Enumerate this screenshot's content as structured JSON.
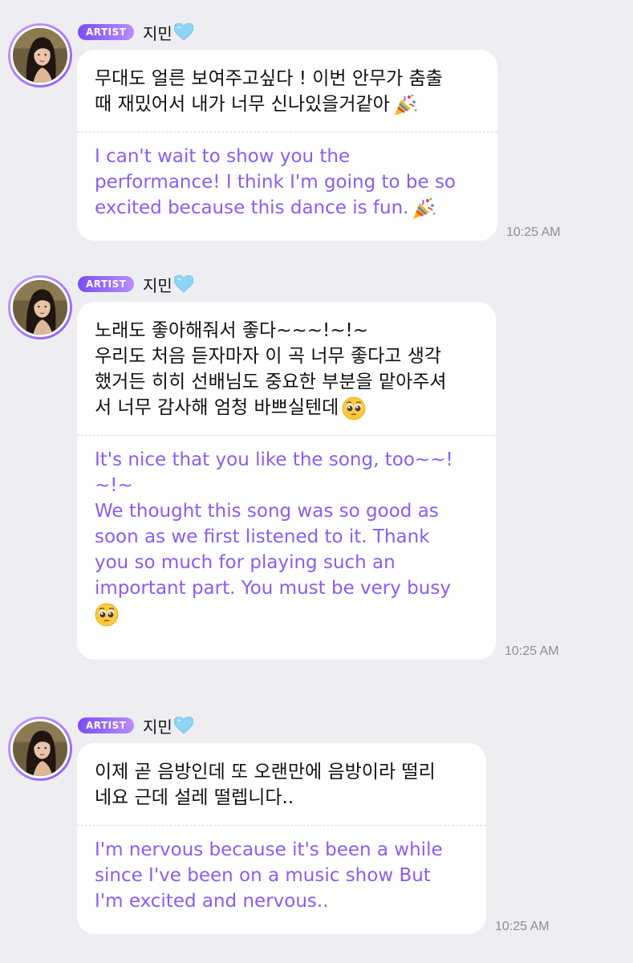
{
  "messages": [
    {
      "badge": "ARTIST",
      "name": "지민",
      "heart_icon": "light-blue-heart-icon",
      "korean": "무대도 얼른 보여주고싶다 ! 이번 안무가 춤출\n때 재밌어서 내가 너무 신나있을거같아",
      "korean_emoji": "party-popper-icon",
      "english": "I can't wait to show you the\nperformance! I think I'm going to be so\nexcited because this dance is fun.",
      "english_emoji": "party-popper-icon",
      "time": "10:25 AM"
    },
    {
      "badge": "ARTIST",
      "name": "지민",
      "heart_icon": "light-blue-heart-icon",
      "korean": "노래도 좋아해줘서 좋다~~~!~!~\n우리도 처음 듣자마자 이 곡 너무 좋다고 생각\n했거든 히히 선배님도 중요한 부분을 맡아주셔\n서 너무 감사해 엄청 바쁘실텐데",
      "korean_emoji": "pleading-face-icon",
      "english": "It's nice that you like the song, too~~!\n~!~\nWe thought this song was so good as\nsoon as we first listened to it. Thank\nyou so much for playing such an\nimportant part. You must be very busy",
      "english_emoji": "pleading-face-icon",
      "time": "10:25 AM"
    },
    {
      "badge": "ARTIST",
      "name": "지민",
      "heart_icon": "light-blue-heart-icon",
      "korean": "이제 곧 음방인데 또 오랜만에 음방이라 떨리\n네요 근데 설레 떨렙니다..",
      "english": "I'm nervous because it's been a while\nsince I've been on a music show But\nI'm excited and nervous..",
      "time": "10:25 AM"
    }
  ],
  "colors": {
    "background": "#eeeef2",
    "bubble": "#ffffff",
    "translation_text": "#8b5cf2",
    "badge_start": "#7b4cf5",
    "badge_end": "#b98cff",
    "timestamp": "#8e8e93",
    "heart": "#8fd3f5"
  }
}
